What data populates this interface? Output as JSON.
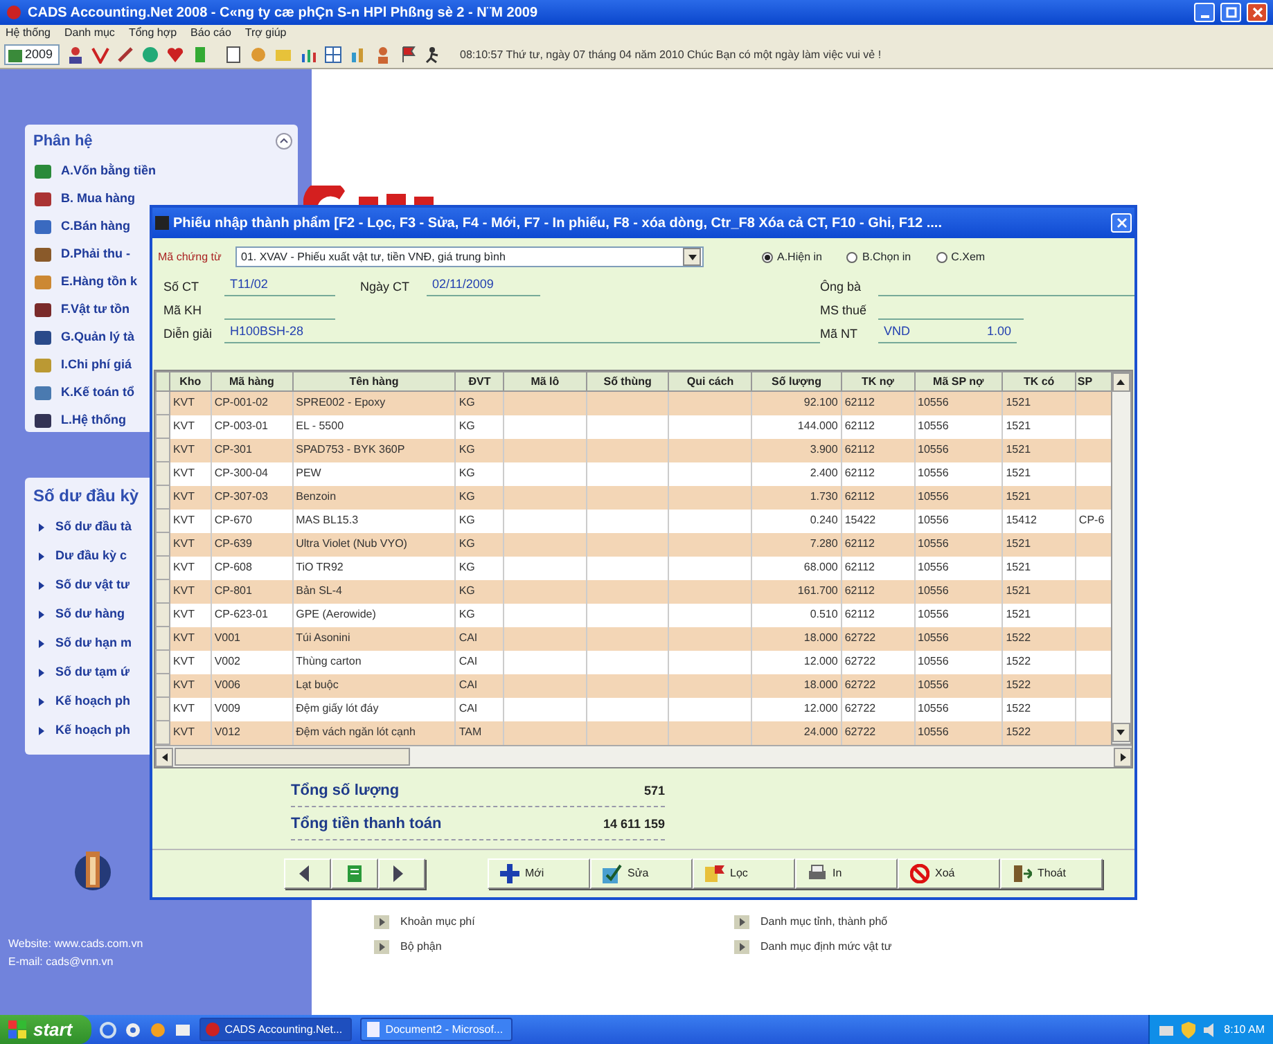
{
  "window": {
    "title": "CADS Accounting.Net 2008 - C«ng ty cæ phÇn S-n HPl Phßng sè 2 - N¨M 2009"
  },
  "menu": [
    "Hệ thống",
    "Danh mục",
    "Tổng hợp",
    "Báo cáo",
    "Trợ giúp"
  ],
  "toolbar": {
    "year": "2009",
    "status": "08:10:57  Thứ tư, ngày 07 tháng 04 năm 2010  Chúc Bạn có một ngày làm việc vui vẻ !"
  },
  "sidebar": {
    "modules": {
      "title": "Phân hệ",
      "items": [
        "A.Vốn bằng tiền",
        "B. Mua hàng",
        "C.Bán hàng",
        "D.Phải thu -",
        "E.Hàng tồn k",
        "F.Vật tư tồn",
        "G.Quản lý tà",
        "I.Chi phí giá",
        "K.Kế toán tổ",
        "L.Hệ thống"
      ]
    },
    "balances": {
      "title": "Số dư đầu kỳ",
      "items": [
        "Số dư đầu tà",
        "Dư đầu kỳ c",
        "Số dư vật tư",
        "Số dư hàng",
        "Số dư hạn m",
        "Số dư tạm ứ",
        "Kế hoạch ph",
        "Kế hoạch ph"
      ]
    },
    "website": "Website: www.cads.com.vn",
    "email": "E-mail: cads@vnn.vn"
  },
  "shortcuts": [
    "Khoản mục phí",
    "Danh mục tỉnh, thành phố",
    "Bộ phận",
    "Danh mục định mức vật tư"
  ],
  "dialog": {
    "title": "Phiếu nhập thành phẩm [F2 - Lọc, F3 - Sửa, F4 - Mới, F7 - In phiếu, F8 - xóa dòng, Ctr_F8 Xóa cả CT, F10 - Ghi, F12 ....",
    "voucher_type": {
      "label": "Mã chứng từ",
      "value": "01. XVAV - Phiếu xuất vật tư, tiền VNĐ, giá trung bình"
    },
    "print_options": [
      {
        "label": "A.Hiện in",
        "selected": true
      },
      {
        "label": "B.Chọn in",
        "selected": false
      },
      {
        "label": "C.Xem",
        "selected": false
      }
    ],
    "fields": [
      {
        "label": "Số CT",
        "value": "T11/02"
      },
      {
        "label": "Ngày CT",
        "value": "02/11/2009"
      },
      {
        "label": "Ông bà"
      },
      {
        "label": "Mã KH"
      },
      {
        "label": "MS thuế"
      },
      {
        "label": "Diễn giải",
        "value": "H100BSH-28"
      },
      {
        "label": "Mã NT",
        "value": "VND",
        "rate": "1.00"
      }
    ],
    "table": {
      "columns": [
        "Kho",
        "Mã hàng",
        "Tên hàng",
        "ĐVT",
        "Mã lô",
        "Số thùng",
        "Qui cách",
        "Số lượng",
        "TK nợ",
        "Mã SP nợ",
        "TK có",
        "SP"
      ],
      "rows": [
        [
          "KVT",
          "CP-001-02",
          "SPRE002 - Epoxy",
          "KG",
          null,
          null,
          null,
          "92.100",
          "62112",
          "10556",
          "1521",
          null
        ],
        [
          "KVT",
          "CP-003-01",
          "EL - 5500",
          "KG",
          null,
          null,
          null,
          "144.000",
          "62112",
          "10556",
          "1521",
          null
        ],
        [
          "KVT",
          "CP-301",
          "SPAD753 - BYK 360P",
          "KG",
          null,
          null,
          null,
          "3.900",
          "62112",
          "10556",
          "1521",
          null
        ],
        [
          "KVT",
          "CP-300-04",
          "PEW",
          "KG",
          null,
          null,
          null,
          "2.400",
          "62112",
          "10556",
          "1521",
          null
        ],
        [
          "KVT",
          "CP-307-03",
          "Benzoin",
          "KG",
          null,
          null,
          null,
          "1.730",
          "62112",
          "10556",
          "1521",
          null
        ],
        [
          "KVT",
          "CP-670",
          "MAS BL15.3",
          "KG",
          null,
          null,
          null,
          "0.240",
          "15422",
          "10556",
          "15412",
          "CP-6"
        ],
        [
          "KVT",
          "CP-639",
          "Ultra Violet (Nub VYO)",
          "KG",
          null,
          null,
          null,
          "7.280",
          "62112",
          "10556",
          "1521",
          null
        ],
        [
          "KVT",
          "CP-608",
          "TiO TR92",
          "KG",
          null,
          null,
          null,
          "68.000",
          "62112",
          "10556",
          "1521",
          null
        ],
        [
          "KVT",
          "CP-801",
          "Bản SL-4",
          "KG",
          null,
          null,
          null,
          "161.700",
          "62112",
          "10556",
          "1521",
          null
        ],
        [
          "KVT",
          "CP-623-01",
          "GPE (Aerowide)",
          "KG",
          null,
          null,
          null,
          "0.510",
          "62112",
          "10556",
          "1521",
          null
        ],
        [
          "KVT",
          "V001",
          "Túi Asonini",
          "CAI",
          null,
          null,
          null,
          "18.000",
          "62722",
          "10556",
          "1522",
          null
        ],
        [
          "KVT",
          "V002",
          "Thùng carton",
          "CAI",
          null,
          null,
          null,
          "12.000",
          "62722",
          "10556",
          "1522",
          null
        ],
        [
          "KVT",
          "V006",
          "Lạt buộc",
          "CAI",
          null,
          null,
          null,
          "18.000",
          "62722",
          "10556",
          "1522",
          null
        ],
        [
          "KVT",
          "V009",
          "Đệm giấy lót đáy",
          "CAI",
          null,
          null,
          null,
          "12.000",
          "62722",
          "10556",
          "1522",
          null
        ],
        [
          "KVT",
          "V012",
          "Đệm vách ngăn lót cạnh",
          "TAM",
          null,
          null,
          null,
          "24.000",
          "62722",
          "10556",
          "1522",
          null
        ]
      ]
    },
    "totals": [
      {
        "label": "Tổng số lượng",
        "value": "571"
      },
      {
        "label": "Tổng tiền thanh toán",
        "value": "14 611 159"
      }
    ],
    "buttons": [
      {
        "kind": "plus",
        "label": "Mới"
      },
      {
        "kind": "edit",
        "label": "Sửa"
      },
      {
        "kind": "filter",
        "label": "Lọc"
      },
      {
        "kind": "print",
        "label": "In"
      },
      {
        "kind": "delete",
        "label": "Xoá"
      },
      {
        "kind": "exit",
        "label": "Thoát"
      }
    ]
  },
  "taskbar": {
    "start": "start",
    "tasks": [
      {
        "label": "CADS Accounting.Net...",
        "selected": true
      },
      {
        "label": "Document2 - Microsof...",
        "selected": false
      }
    ],
    "clock": "8:10 AM"
  }
}
